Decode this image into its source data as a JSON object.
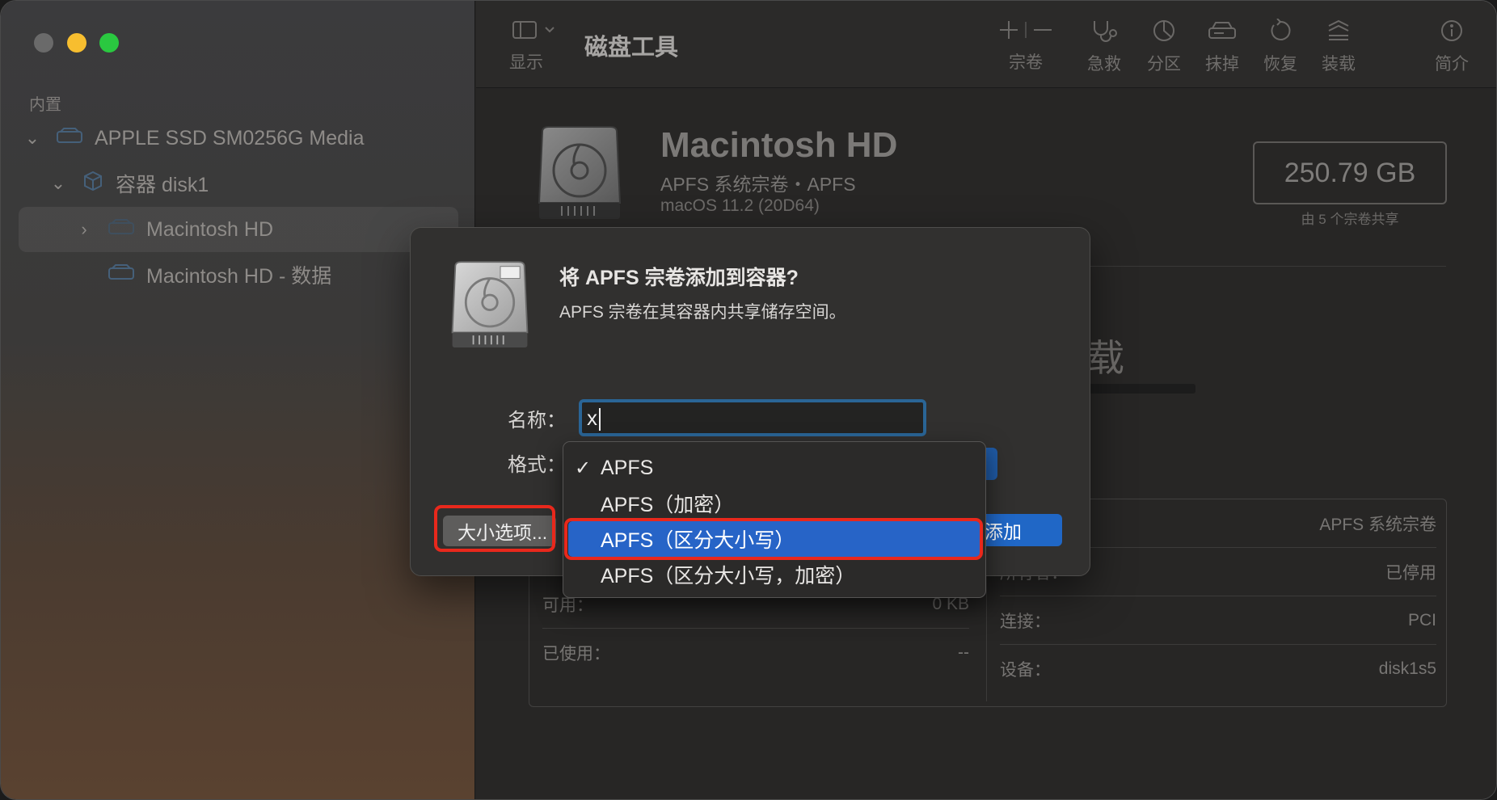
{
  "app": {
    "title": "磁盘工具"
  },
  "sidebar": {
    "section": "内置",
    "items": [
      {
        "label": "APPLE SSD SM0256G Media"
      },
      {
        "label": "容器 disk1"
      },
      {
        "label": "Macintosh HD"
      },
      {
        "label": "Macintosh HD - 数据"
      }
    ]
  },
  "toolbar": {
    "view_label": "显示",
    "volume_label": "宗卷",
    "first_aid_label": "急救",
    "partition_label": "分区",
    "erase_label": "抹掉",
    "restore_label": "恢复",
    "mount_label": "装载",
    "info_label": "简介"
  },
  "volume": {
    "name": "Macintosh HD",
    "subtitle": "APFS 系统宗卷・APFS",
    "os": "macOS 11.2 (20D64)",
    "size": "250.79 GB",
    "size_note": "由 5 个宗卷共享",
    "blurb": "载",
    "info": {
      "left": [
        {
          "label": "可用：",
          "value": "0 KB"
        },
        {
          "label": "已使用：",
          "value": "--"
        }
      ],
      "right": [
        {
          "label": "",
          "value": "APFS 系统宗卷"
        },
        {
          "label": "所有者：",
          "value": "已停用"
        },
        {
          "label": "连接：",
          "value": "PCI"
        },
        {
          "label": "设备：",
          "value": "disk1s5"
        }
      ]
    }
  },
  "dialog": {
    "title": "将 APFS 宗卷添加到容器?",
    "message": "APFS 宗卷在其容器内共享储存空间。",
    "name_label": "名称：",
    "name_value": "x",
    "format_label": "格式：",
    "size_options_label": "大小选项...",
    "add_label": "添加"
  },
  "format_menu": {
    "selected_index": 0,
    "highlighted_index": 2,
    "options": [
      "APFS",
      "APFS（加密）",
      "APFS（区分大小写）",
      "APFS（区分大小写，加密）"
    ]
  },
  "colors": {
    "accent": "#2764c7",
    "annotation": "#e8281c"
  }
}
